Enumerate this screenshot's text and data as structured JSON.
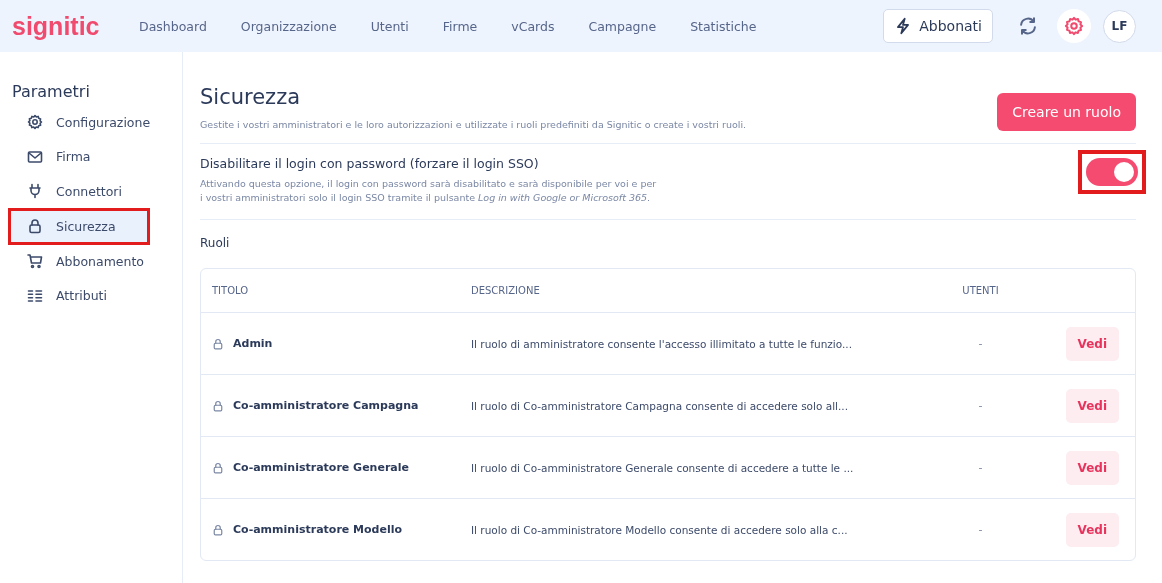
{
  "header": {
    "logo": "signitic",
    "nav": [
      {
        "label": "Dashboard",
        "selected": false
      },
      {
        "label": "Organizzazione",
        "selected": false
      },
      {
        "label": "Utenti",
        "selected": false
      },
      {
        "label": "Firme",
        "selected": false
      },
      {
        "label": "vCards",
        "selected": false
      },
      {
        "label": "Campagne",
        "selected": false
      },
      {
        "label": "Statistiche",
        "selected": false
      }
    ],
    "subscribe_button": "Abbonati",
    "avatar": "LF"
  },
  "sidebar": {
    "title": "Parametri",
    "items": [
      {
        "label": "Configurazione",
        "kind": "gear",
        "selected": false,
        "highlighted": false
      },
      {
        "label": "Firma",
        "kind": "mail",
        "selected": false,
        "highlighted": false
      },
      {
        "label": "Connettori",
        "kind": "plug",
        "selected": false,
        "highlighted": false
      },
      {
        "label": "Sicurezza",
        "kind": "lock",
        "selected": true,
        "highlighted": true
      },
      {
        "label": "Abbonamento",
        "kind": "cart",
        "selected": false,
        "highlighted": false
      },
      {
        "label": "Attributi",
        "kind": "list",
        "selected": false,
        "highlighted": false
      }
    ]
  },
  "page": {
    "title": "Sicurezza",
    "subtitle": "Gestite i vostri amministratori e le loro autorizzazioni e utilizzate i ruoli predefiniti da Signitic o create i vostri ruoli.",
    "create_button": "Creare un ruolo"
  },
  "sso": {
    "title": "Disabilitare il login con password (forzare il login SSO)",
    "description": "Attivando questa opzione, il login con password sarà disabilitato e sarà disponibile per voi e per i vostri amministratori solo il login SSO tramite il pulsante *Log in with Google or Microsoft 365*.",
    "on": true,
    "highlighted": true
  },
  "roles": {
    "title": "Ruoli",
    "columns": [
      "TITOLO",
      "DESCRIZIONE",
      "UTENTI"
    ],
    "rows": [
      {
        "title": "Admin",
        "description": "Il ruolo di amministratore consente l'accesso illimitato a tutte le funzio...",
        "users": "-",
        "action": "Vedi"
      },
      {
        "title": "Co-amministratore Campagna",
        "description": "Il ruolo di Co-amministratore Campagna consente di accedere solo all...",
        "users": "-",
        "action": "Vedi"
      },
      {
        "title": "Co-amministratore Generale",
        "description": "Il ruolo di Co-amministratore Generale consente di accedere a tutte le ...",
        "users": "-",
        "action": "Vedi"
      },
      {
        "title": "Co-amministratore Modello",
        "description": "Il ruolo di Co-amministratore Modello consente di accedere solo alla c...",
        "users": "-",
        "action": "Vedi"
      }
    ]
  }
}
